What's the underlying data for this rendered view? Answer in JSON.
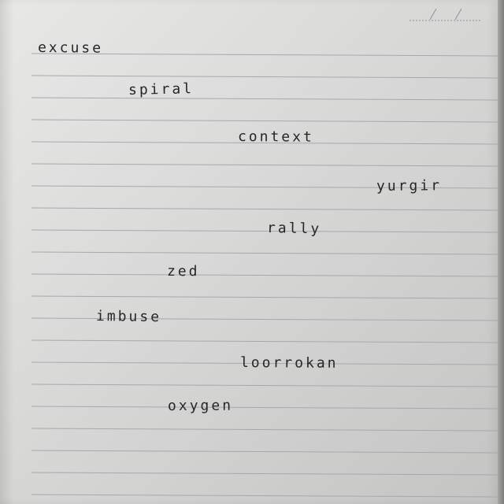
{
  "notebook": {
    "date_field": "/ /",
    "handwritten_words": [
      "excuse",
      "spiral",
      "context",
      "yurgir",
      "rally",
      "zed",
      "imbuse",
      "loorrokan",
      "oxygen"
    ]
  },
  "colors": {
    "paper": "#dcdcda",
    "ruled_line": "#a7a8ae",
    "ink": "#26262a",
    "background": "#8f8d88"
  }
}
